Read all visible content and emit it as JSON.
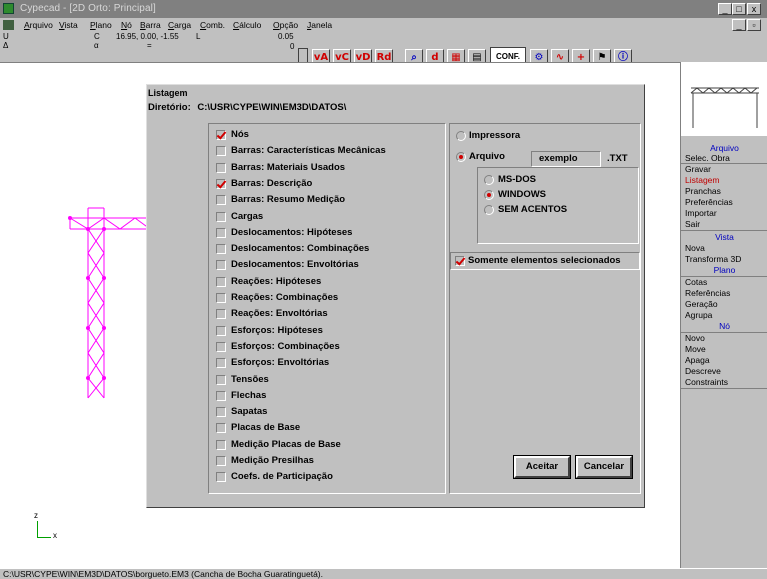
{
  "window": {
    "title": "Cypecad - [2D Orto: Principal]",
    "min": "_",
    "max": "□",
    "close": "x",
    "min2": "_",
    "restore": "▫",
    "close2": "x"
  },
  "menu": [
    "Arquivo",
    "Vista",
    "Plano",
    "Nó",
    "Barra",
    "Carga",
    "Comb.",
    "Cálculo",
    "Opção",
    "Janela"
  ],
  "toolbar": {
    "u_label": "U",
    "delta_label": "Δ",
    "c_label": "C",
    "alpha_label": "α",
    "coords": "16.95, 0.00, -1.55",
    "l_label": "L",
    "dot": "=",
    "spin_top": "0.05",
    "spin_bot": "0",
    "buttons": [
      "vA",
      "vC",
      "vD",
      "Rd"
    ],
    "conf": "CONF."
  },
  "dialog": {
    "title": "Listagem",
    "dir_label": "Diretório:",
    "dir_path": "C:\\USR\\CYPE\\WIN\\EM3D\\DATOS\\",
    "items": [
      {
        "label": "Nós",
        "checked": true
      },
      {
        "label": "Barras: Características Mecânicas",
        "checked": false
      },
      {
        "label": "Barras: Materiais Usados",
        "checked": false
      },
      {
        "label": "Barras: Descrição",
        "checked": true
      },
      {
        "label": "Barras: Resumo Medição",
        "checked": false
      },
      {
        "label": "Cargas",
        "checked": false
      },
      {
        "label": "Deslocamentos: Hipóteses",
        "checked": false
      },
      {
        "label": "Deslocamentos: Combinações",
        "checked": false
      },
      {
        "label": "Deslocamentos: Envoltórias",
        "checked": false
      },
      {
        "label": "Reações: Hipóteses",
        "checked": false
      },
      {
        "label": "Reações: Combinações",
        "checked": false
      },
      {
        "label": "Reações: Envoltórias",
        "checked": false
      },
      {
        "label": "Esforços: Hipóteses",
        "checked": false
      },
      {
        "label": "Esforços: Combinações",
        "checked": false
      },
      {
        "label": "Esforços: Envoltórias",
        "checked": false
      },
      {
        "label": "Tensões",
        "checked": false
      },
      {
        "label": "Flechas",
        "checked": false
      },
      {
        "label": "Sapatas",
        "checked": false
      },
      {
        "label": "Placas de Base",
        "checked": false
      },
      {
        "label": "Medição Placas de Base",
        "checked": false
      },
      {
        "label": "Medição Presilhas",
        "checked": false
      },
      {
        "label": "Coefs. de Participação",
        "checked": false
      }
    ],
    "output": {
      "printer": "Impressora",
      "file": "Arquivo",
      "filename": "exemplo",
      "ext": ".TXT",
      "selected": "Arquivo"
    },
    "charset": {
      "options": [
        "MS-DOS",
        "WINDOWS",
        "SEM ACENTOS"
      ],
      "selected": "WINDOWS"
    },
    "only_selected": {
      "label": "Somente elementos selecionados",
      "checked": true
    },
    "ok": "Aceitar",
    "cancel": "Cancelar"
  },
  "right_menu": {
    "groups": [
      {
        "head": "Arquivo",
        "items": [
          "Selec. Obra",
          "Gravar",
          "Listagem",
          "Pranchas",
          "Preferências",
          "Importar",
          "Sair"
        ]
      },
      {
        "head": "Vista",
        "items": [
          "Nova",
          "Transforma 3D"
        ]
      },
      {
        "head": "Plano",
        "items": [
          "Cotas",
          "Referências",
          "Geração",
          "Agrupa"
        ]
      },
      {
        "head": "Nó",
        "items": [
          "Novo",
          "Move",
          "Apaga",
          "Descreve",
          "Constraints"
        ]
      }
    ],
    "selected": "Listagem"
  },
  "axes": {
    "z": "z",
    "x": "x"
  },
  "status": "C:\\USR\\CYPE\\WIN\\EM3D\\DATOS\\borgueto.EM3 (Cancha de Bocha Guaratinguetá).",
  "colors": {
    "structure": "#ff00ff",
    "check": "#d00000",
    "menu_head": "#0000c0"
  }
}
